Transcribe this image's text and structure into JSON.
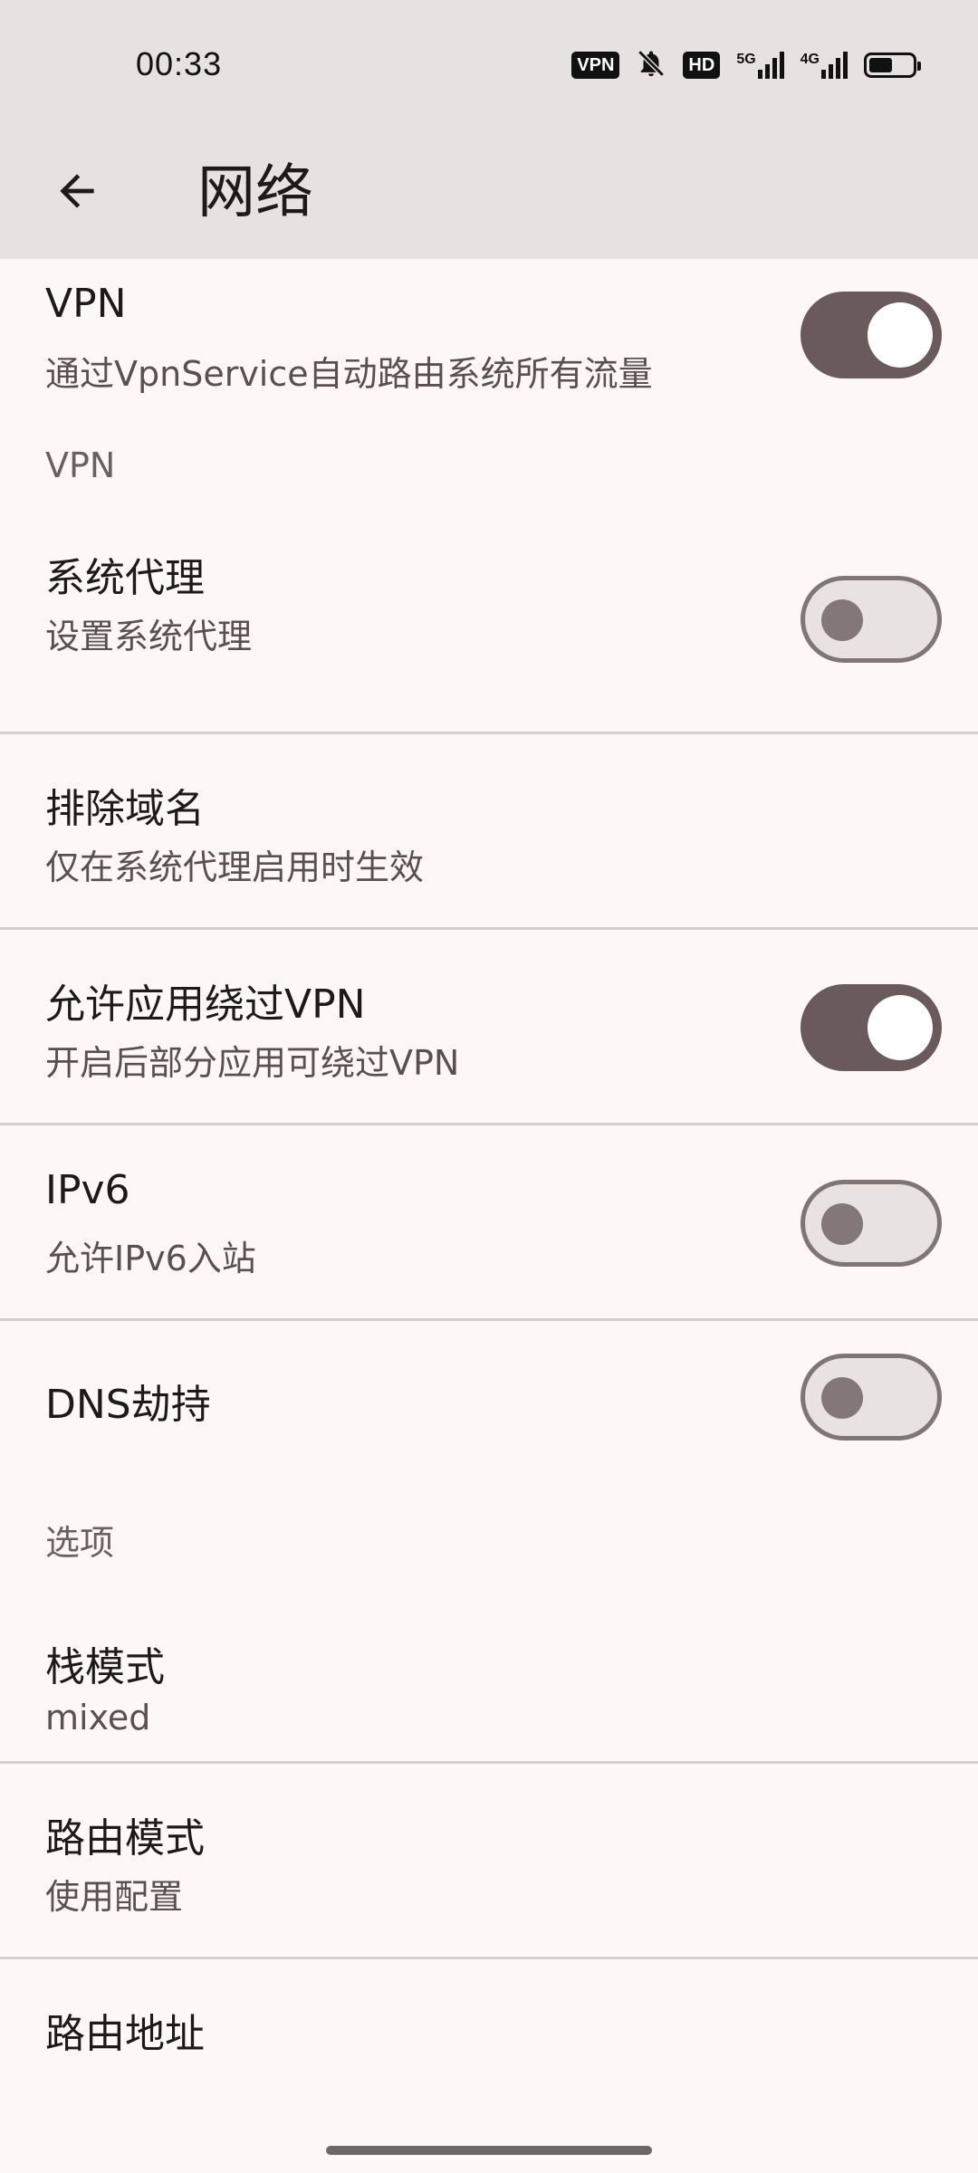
{
  "status_bar": {
    "time": "00:33",
    "vpn_badge": "VPN",
    "hd_badge": "HD",
    "net1_label": "5G",
    "net2_label": "4G",
    "battery_level": 0.55,
    "icons": [
      "vpn-badge-icon",
      "bell-off-icon",
      "hd-voice-icon",
      "signal-5g-icon",
      "signal-4g-icon",
      "battery-icon"
    ]
  },
  "app_bar": {
    "back_icon": "arrow-back-icon",
    "title": "网络"
  },
  "settings": {
    "vpn": {
      "title": "VPN",
      "subtitle": "通过VpnService自动路由系统所有流量",
      "enabled": true
    },
    "section_vpn": "VPN",
    "system_proxy": {
      "title": "系统代理",
      "subtitle": "设置系统代理",
      "enabled": false
    },
    "bypass_domains": {
      "title": "排除域名",
      "subtitle": "仅在系统代理启用时生效"
    },
    "allow_bypass": {
      "title": "允许应用绕过VPN",
      "subtitle": "开启后部分应用可绕过VPN",
      "enabled": true
    },
    "ipv6": {
      "title": "IPv6",
      "subtitle": "允许IPv6入站",
      "enabled": false
    },
    "dns_hijack": {
      "title": "DNS劫持",
      "enabled": false
    },
    "section_options": "选项",
    "stack_mode": {
      "title": "栈模式",
      "value": "mixed"
    },
    "route_mode": {
      "title": "路由模式",
      "value": "使用配置"
    },
    "route_address": {
      "title": "路由地址"
    }
  }
}
